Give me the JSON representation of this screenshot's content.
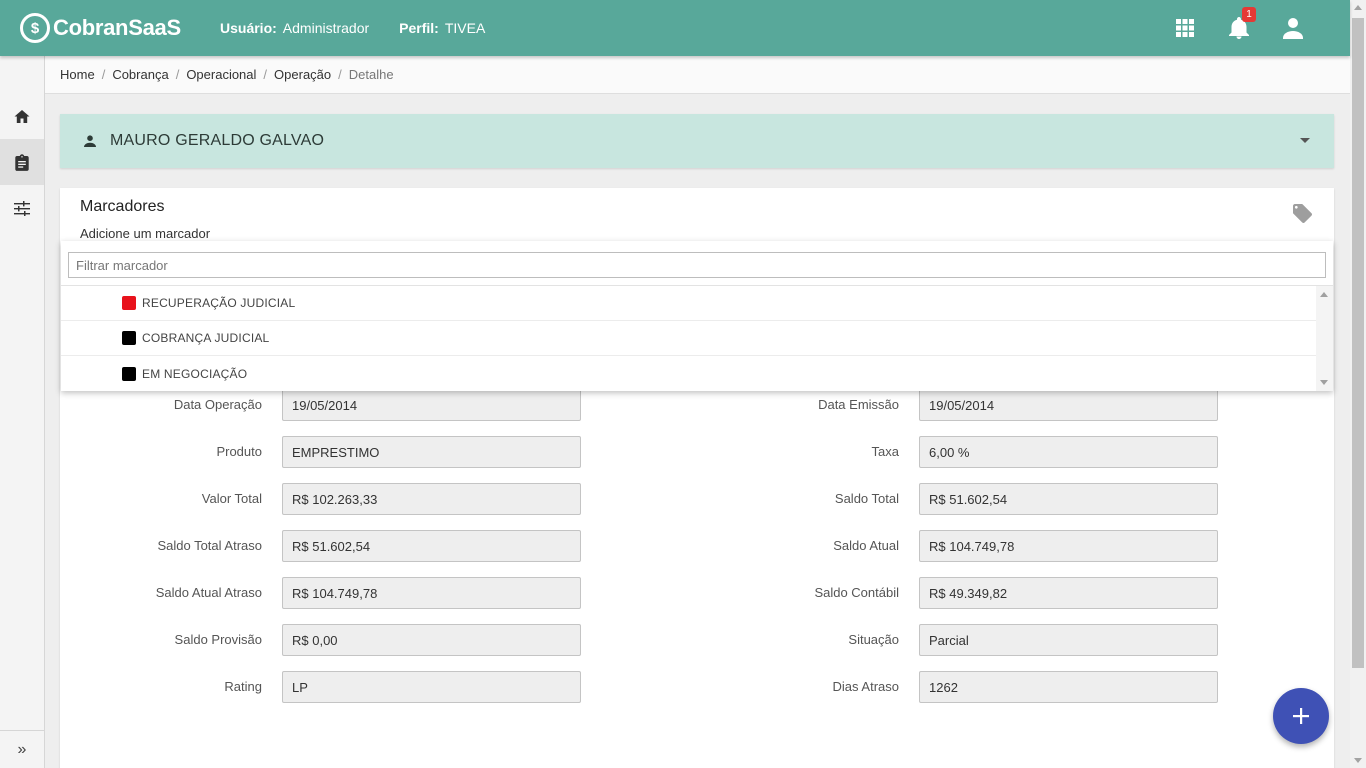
{
  "header": {
    "logo_text": "CobranSaaS",
    "logo_mark": "$",
    "user_label": "Usuário:",
    "user_value": "Administrador",
    "profile_label": "Perfil:",
    "profile_value": "TIVEA",
    "notification_count": "1",
    "icons": [
      "apps-grid-icon",
      "bell-icon",
      "account-icon"
    ]
  },
  "sidebar": {
    "items": [
      {
        "icon": "home-icon",
        "active": false
      },
      {
        "icon": "clipboard-icon",
        "active": true
      },
      {
        "icon": "tune-icon",
        "active": false
      }
    ],
    "expand_label": "»"
  },
  "breadcrumb": {
    "items": [
      "Home",
      "Cobrança",
      "Operacional",
      "Operação",
      "Detalhe"
    ],
    "separator": "/"
  },
  "client": {
    "name": "MAURO GERALDO GALVAO",
    "icon": "person-icon"
  },
  "markers": {
    "title": "Marcadores",
    "subtitle": "Adicione um marcador",
    "filter_placeholder": "Filtrar marcador",
    "filter_value": "",
    "options": [
      {
        "label": "RECUPERAÇÃO JUDICIAL",
        "color": "#e8121c"
      },
      {
        "label": "COBRANÇA JUDICIAL",
        "color": "#000000"
      },
      {
        "label": "EM NEGOCIAÇÃO",
        "color": "#000000"
      }
    ]
  },
  "fields_left": [
    {
      "label": "Data Operação",
      "value": "19/05/2014"
    },
    {
      "label": "Produto",
      "value": "EMPRESTIMO"
    },
    {
      "label": "Valor Total",
      "value": "R$ 102.263,33"
    },
    {
      "label": "Saldo Total Atraso",
      "value": "R$ 51.602,54"
    },
    {
      "label": "Saldo Atual Atraso",
      "value": "R$ 104.749,78"
    },
    {
      "label": "Saldo Provisão",
      "value": "R$ 0,00"
    },
    {
      "label": "Rating",
      "value": "LP"
    }
  ],
  "fields_right": [
    {
      "label": "Data Emissão",
      "value": "19/05/2014"
    },
    {
      "label": "Taxa",
      "value": "6,00 %"
    },
    {
      "label": "Saldo Total",
      "value": "R$ 51.602,54"
    },
    {
      "label": "Saldo Atual",
      "value": "R$ 104.749,78"
    },
    {
      "label": "Saldo Contábil",
      "value": "R$ 49.349,82"
    },
    {
      "label": "Situação",
      "value": "Parcial"
    },
    {
      "label": "Dias Atraso",
      "value": "1262"
    }
  ],
  "fab": {
    "label": "+",
    "icon": "plus-icon"
  },
  "colors": {
    "header_bg": "#58a89a",
    "client_bar_bg": "#c8e6df",
    "fab_bg": "#3f51b5",
    "badge_bg": "#e53935"
  }
}
